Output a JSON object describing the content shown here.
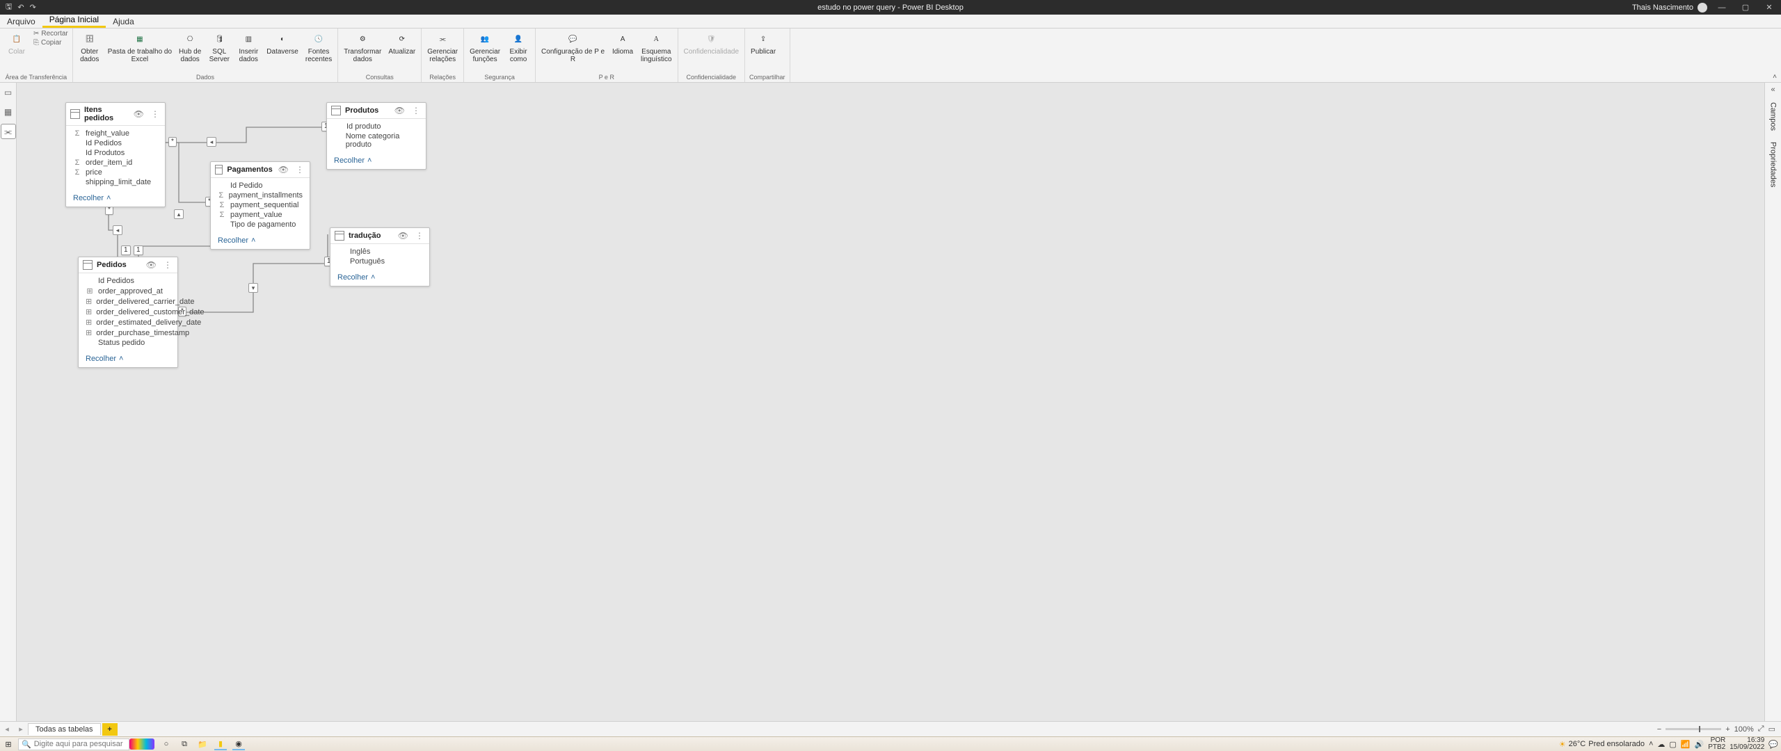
{
  "titlebar": {
    "title": "estudo no power query - Power BI Desktop",
    "user": "Thais Nascimento"
  },
  "menu": {
    "file": "Arquivo",
    "home": "Página Inicial",
    "help": "Ajuda"
  },
  "ribbon": {
    "clipboard": {
      "paste": "Colar",
      "cut": "Recortar",
      "copy": "Copiar",
      "group": "Área de Transferência"
    },
    "data": {
      "get": "Obter\ndados",
      "excel": "Pasta de trabalho do\nExcel",
      "hub": "Hub de\ndados",
      "sql": "SQL\nServer",
      "enter": "Inserir\ndados",
      "dataverse": "Dataverse",
      "recent": "Fontes\nrecentes",
      "group": "Dados"
    },
    "queries": {
      "transform": "Transformar\ndados",
      "refresh": "Atualizar",
      "group": "Consultas"
    },
    "relations": {
      "manage": "Gerenciar\nrelações",
      "group": "Relações"
    },
    "security": {
      "roles": "Gerenciar\nfunções",
      "viewas": "Exibir\ncomo",
      "group": "Segurança"
    },
    "qna": {
      "setup": "Configuração de P e\nR",
      "lang": "Idioma",
      "schema": "Esquema\nlinguístico",
      "group": "P e R"
    },
    "sensitivity": {
      "label": "Confidencialidade",
      "group": "Confidencialidade"
    },
    "share": {
      "publish": "Publicar",
      "group": "Compartilhar"
    }
  },
  "rightpanes": {
    "fields": "Campos",
    "properties": "Propriedades"
  },
  "tables": {
    "itens": {
      "name": "Itens pedidos",
      "fields": [
        {
          "icon": "Σ",
          "n": "freight_value"
        },
        {
          "icon": "",
          "n": "Id Pedidos"
        },
        {
          "icon": "",
          "n": "Id Produtos"
        },
        {
          "icon": "Σ",
          "n": "order_item_id"
        },
        {
          "icon": "Σ",
          "n": "price"
        },
        {
          "icon": "",
          "n": "shipping_limit_date"
        }
      ],
      "collapse": "Recolher"
    },
    "produtos": {
      "name": "Produtos",
      "fields": [
        {
          "icon": "",
          "n": "Id produto"
        },
        {
          "icon": "",
          "n": "Nome categoria produto"
        }
      ],
      "collapse": "Recolher"
    },
    "pagamentos": {
      "name": "Pagamentos",
      "fields": [
        {
          "icon": "",
          "n": "Id Pedido"
        },
        {
          "icon": "Σ",
          "n": "payment_installments"
        },
        {
          "icon": "Σ",
          "n": "payment_sequential"
        },
        {
          "icon": "Σ",
          "n": "payment_value"
        },
        {
          "icon": "",
          "n": "Tipo de pagamento"
        }
      ],
      "collapse": "Recolher"
    },
    "traducao": {
      "name": "tradução",
      "fields": [
        {
          "icon": "",
          "n": "Inglês"
        },
        {
          "icon": "",
          "n": "Português"
        }
      ],
      "collapse": "Recolher"
    },
    "pedidos": {
      "name": "Pedidos",
      "fields": [
        {
          "icon": "",
          "n": "Id Pedidos"
        },
        {
          "icon": "⊞",
          "n": "order_approved_at"
        },
        {
          "icon": "⊞",
          "n": "order_delivered_carrier_date"
        },
        {
          "icon": "⊞",
          "n": "order_delivered_customer_date"
        },
        {
          "icon": "⊞",
          "n": "order_estimated_delivery_date"
        },
        {
          "icon": "⊞",
          "n": "order_purchase_timestamp"
        },
        {
          "icon": "",
          "n": "Status pedido"
        }
      ],
      "collapse": "Recolher"
    }
  },
  "tabstrip": {
    "tab": "Todas as tabelas",
    "zoom": "100%"
  },
  "taskbar": {
    "search": "Digite aqui para pesquisar",
    "weather_temp": "26°C",
    "weather_label": "Pred ensolarado",
    "lang1": "POR",
    "lang2": "PTB2",
    "time": "16:39",
    "date": "15/09/2022"
  }
}
